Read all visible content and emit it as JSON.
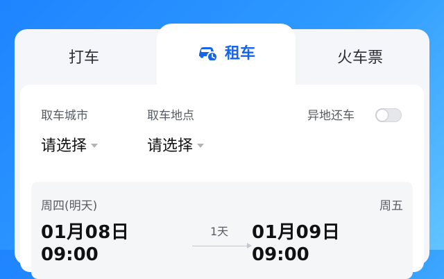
{
  "tabs": {
    "taxi": "打车",
    "rental": "租车",
    "train": "火车票"
  },
  "form": {
    "pickup_city_label": "取车城市",
    "pickup_city_value": "请选择",
    "pickup_location_label": "取车地点",
    "pickup_location_value": "请选择",
    "return_elsewhere_label": "异地还车",
    "return_elsewhere_on": false
  },
  "dates": {
    "pickup_day": "周四(明天)",
    "pickup_date": "01月08日",
    "pickup_time": "09:00",
    "duration": "1天",
    "return_day": "周五",
    "return_date": "01月09日",
    "return_time": "09:00"
  },
  "colors": {
    "accent": "#1565e6",
    "background": "#2f9bff"
  },
  "icons": {
    "rental_tab": "car-clock-icon"
  }
}
